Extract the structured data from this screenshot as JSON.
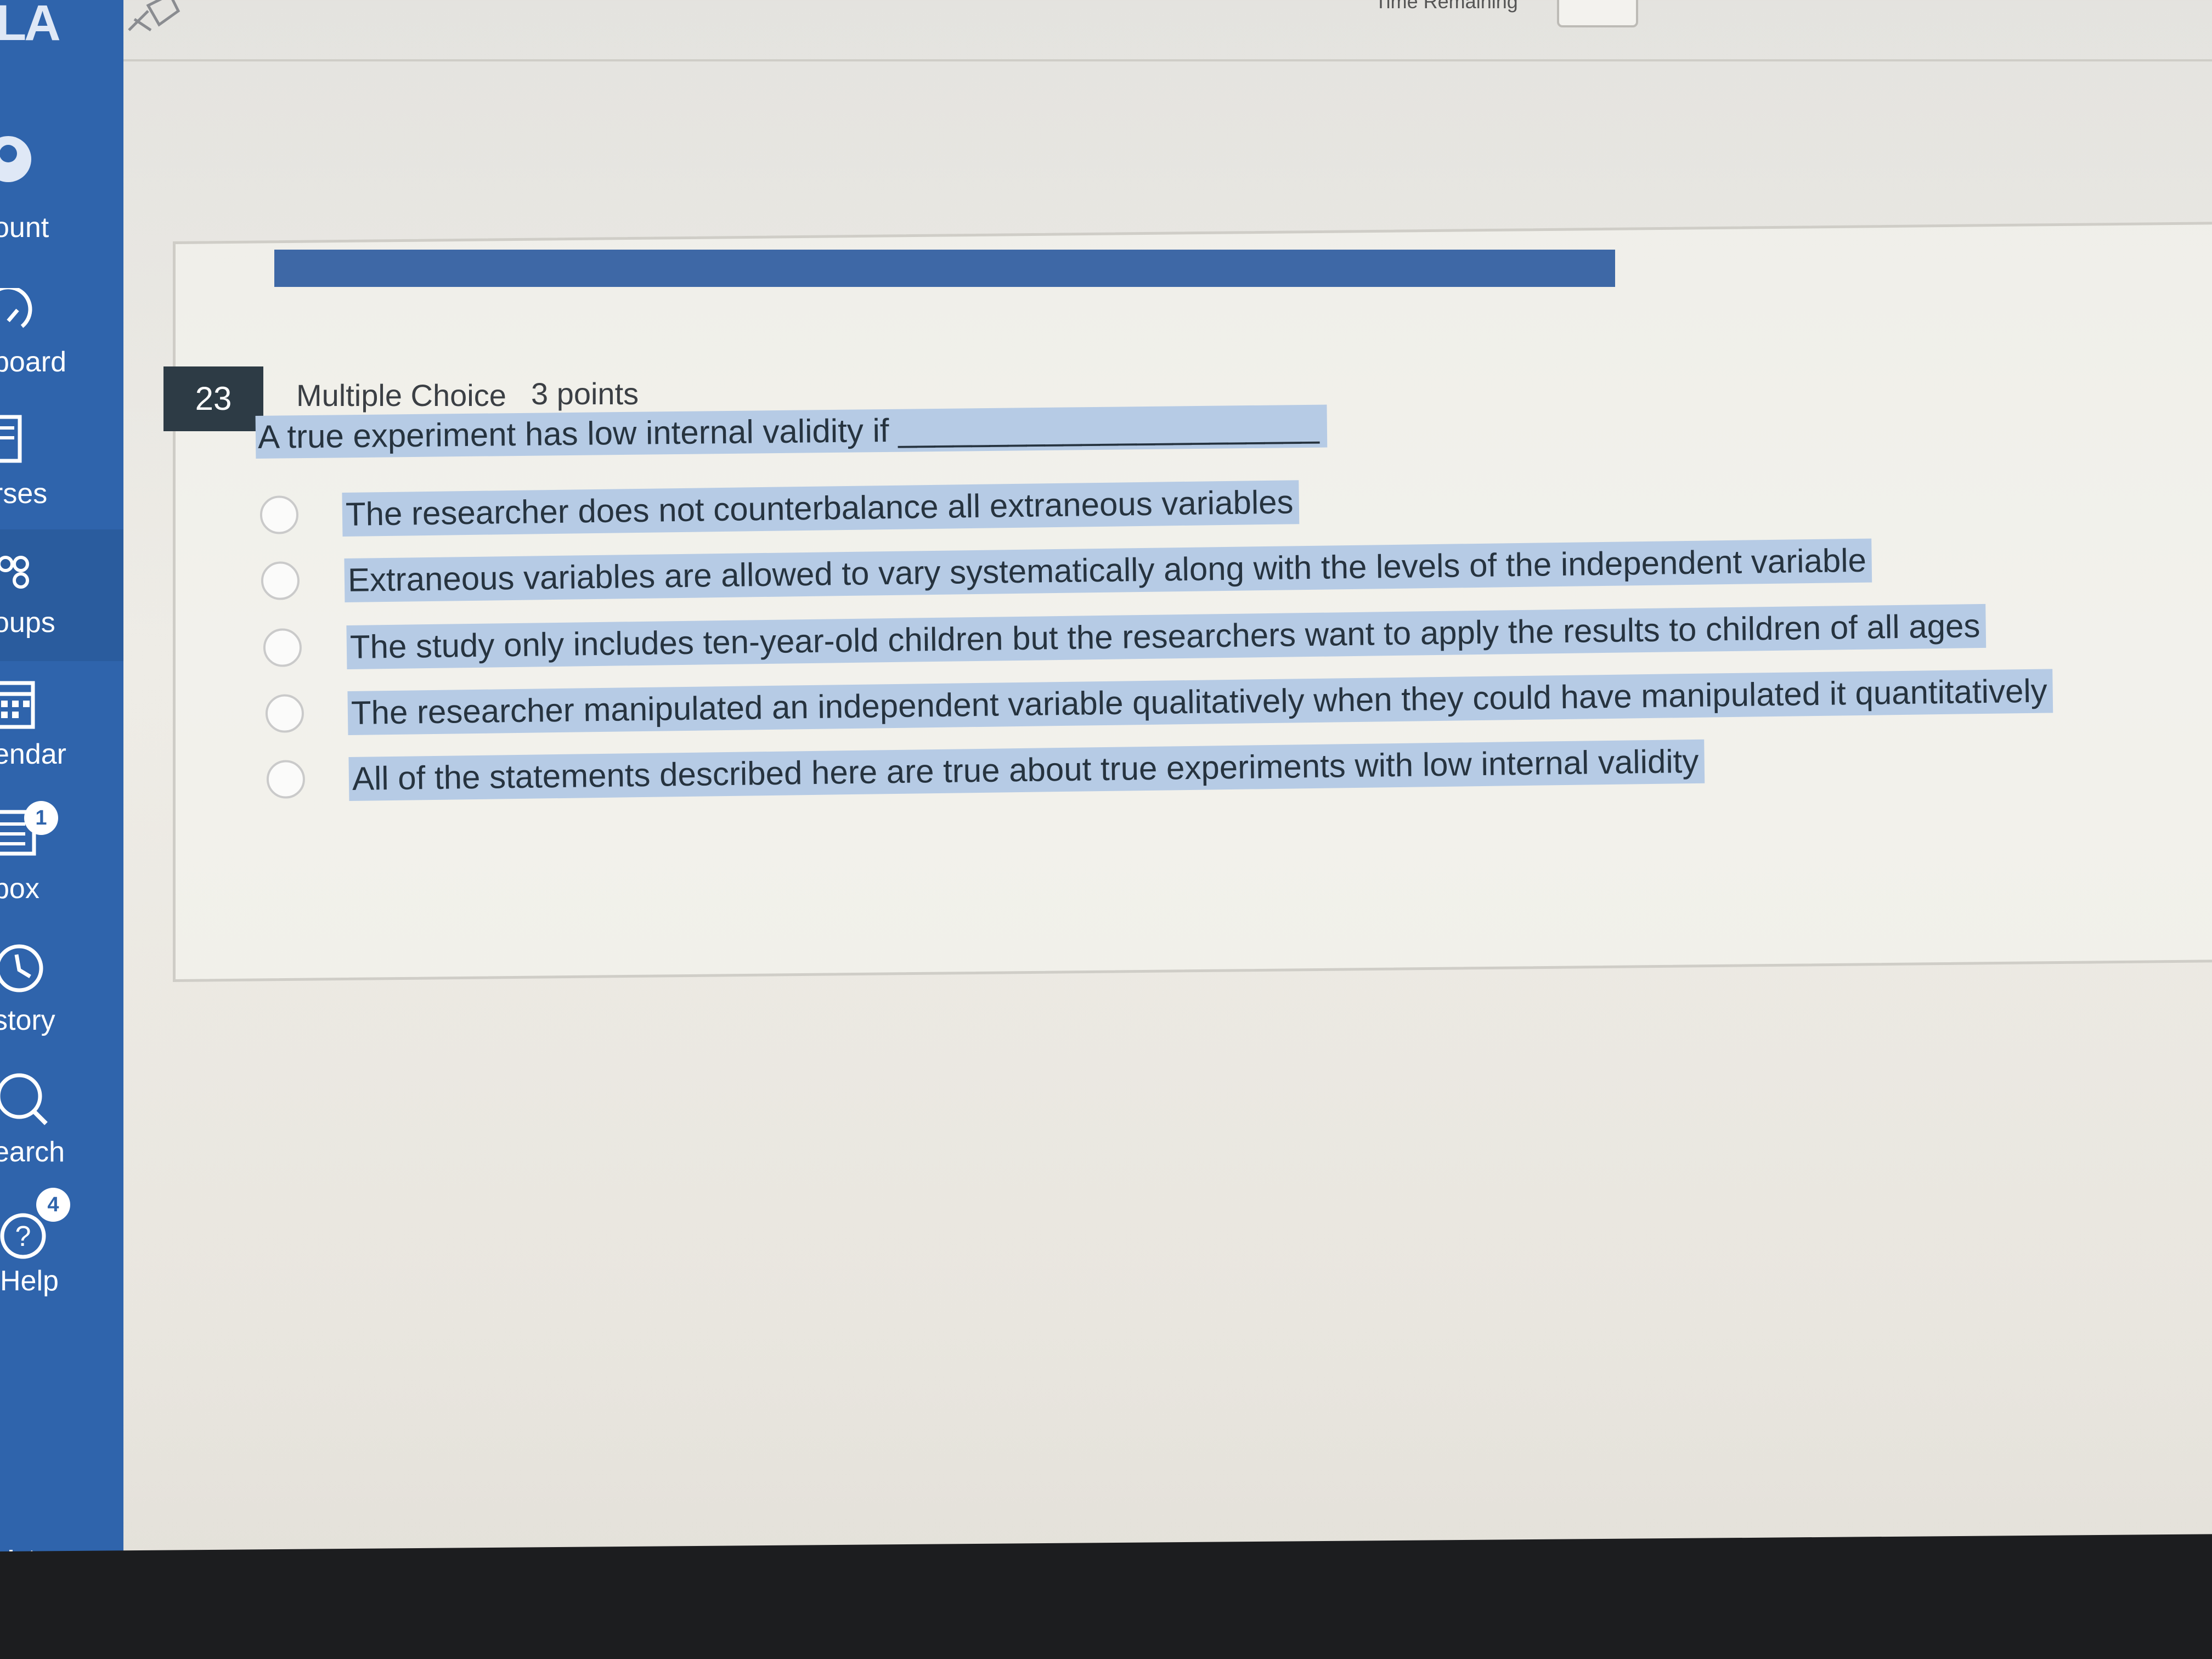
{
  "app": {
    "logo_text": "LA",
    "colors": {
      "nav_background": "#2f64ac",
      "progress_bar": "#3e68a6",
      "selection_highlight": "#b6cbe5",
      "question_badge": "#2d3b45"
    }
  },
  "global_nav": {
    "items": [
      {
        "label": "ount",
        "icon": "account-icon"
      },
      {
        "label": "board",
        "icon": "dashboard-icon"
      },
      {
        "label": "rses",
        "icon": "courses-icon"
      },
      {
        "label": "oups",
        "icon": "groups-icon"
      },
      {
        "label": "endar",
        "icon": "calendar-icon"
      },
      {
        "label": "box",
        "icon": "inbox-icon",
        "badge": "1"
      },
      {
        "label": "story",
        "icon": "history-icon"
      },
      {
        "label": "earch",
        "icon": "search-icon"
      },
      {
        "label": "Help",
        "icon": "help-icon",
        "badge": "4"
      }
    ],
    "collapse_icon": "collapse-arrow-icon"
  },
  "top_bar": {
    "pin_icon": "pin-icon",
    "timer_label": "Time Remaining"
  },
  "quiz": {
    "progress_bar_fraction": 0.65,
    "question": {
      "number": "23",
      "type": "Multiple Choice",
      "points": "3 points",
      "text": "A true experiment has low internal validity if _______________________",
      "answers": [
        {
          "label": "The researcher does not counterbalance all extraneous variables",
          "selected": false
        },
        {
          "label": "Extraneous variables are allowed to vary systematically along with the levels of the independent variable",
          "selected": false
        },
        {
          "label": "The study only includes ten-year-old children but the researchers want to apply the results to children of all ages",
          "selected": false
        },
        {
          "label": "The researcher manipulated an independent variable qualitatively when they could have manipulated it quantitatively",
          "selected": false
        },
        {
          "label": "All of the statements described here are true about true experiments with low internal validity",
          "selected": false
        }
      ]
    }
  }
}
